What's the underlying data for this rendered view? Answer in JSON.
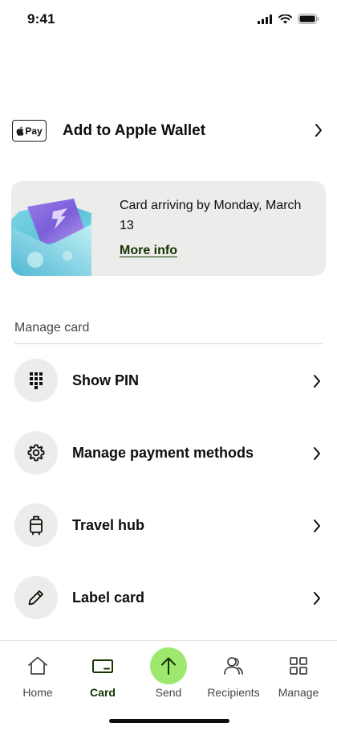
{
  "status_bar": {
    "time": "9:41"
  },
  "wallet": {
    "badge_text": "Pay",
    "label": "Add to Apple Wallet"
  },
  "arrival": {
    "message": "Card arriving by Monday, March 13",
    "link_label": "More info"
  },
  "manage_section": {
    "title": "Manage card",
    "items": [
      {
        "label": "Show PIN",
        "icon": "keypad-icon"
      },
      {
        "label": "Manage payment methods",
        "icon": "gear-icon"
      },
      {
        "label": "Travel hub",
        "icon": "luggage-icon"
      },
      {
        "label": "Label card",
        "icon": "pencil-icon"
      }
    ]
  },
  "tabs": [
    {
      "label": "Home",
      "icon": "home-icon"
    },
    {
      "label": "Card",
      "icon": "card-icon",
      "active": true
    },
    {
      "label": "Send",
      "icon": "send-arrow-icon"
    },
    {
      "label": "Recipients",
      "icon": "recipients-icon"
    },
    {
      "label": "Manage",
      "icon": "grid-icon"
    }
  ],
  "colors": {
    "accent_green": "#9fe870",
    "dark_green": "#163300",
    "surface": "#ecedea",
    "text": "#0e0f0c"
  }
}
